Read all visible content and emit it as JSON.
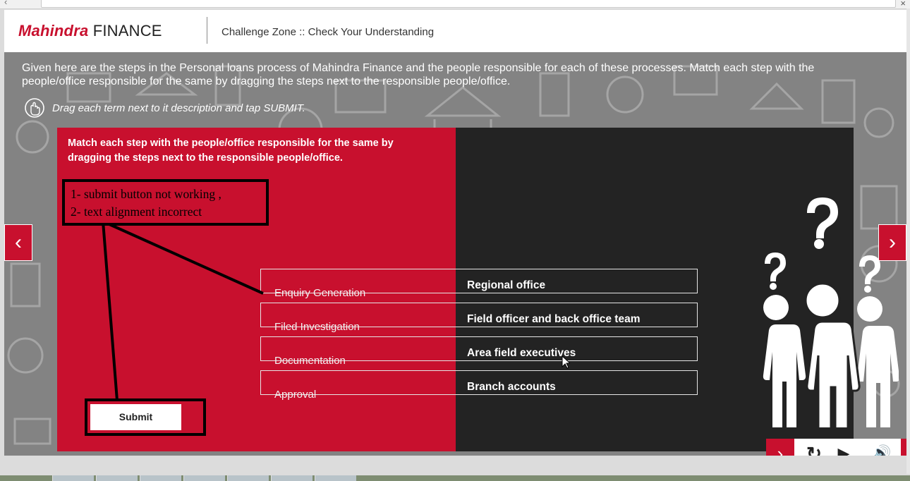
{
  "header": {
    "logo_brand": "Mahindra",
    "logo_suffix": "FINANCE",
    "title": "Challenge Zone :: Check Your Understanding"
  },
  "intro": {
    "text": "Given here are the steps in the Personal loans process of Mahindra Finance and the people responsible for each of these processes. Match each step with the people/office responsible for the same by dragging the steps next to the responsible people/office.",
    "hint": "Drag each term next to it description and tap SUBMIT."
  },
  "activity": {
    "instruction": "Match each step with the people/office responsible for the same by dragging the steps next to the responsible people/office.",
    "rows": [
      {
        "step": "Enquiry Generation",
        "target": "Regional office"
      },
      {
        "step": "Filed Investigation",
        "target": "Field officer and back office team"
      },
      {
        "step": "Documentation",
        "target": "Area field executives"
      },
      {
        "step": "Approval",
        "target": "Branch accounts"
      }
    ],
    "submit_label": "Submit"
  },
  "annotation": {
    "line1": "1- submit button not working ,",
    "line2": "2- text alignment incorrect"
  },
  "navigation": {
    "prev_glyph": "‹",
    "next_glyph": "›"
  },
  "controls": {
    "next_glyph": "›",
    "replay_glyph": "↻",
    "play_glyph": "▶",
    "volume_glyph": "🔊"
  },
  "colors": {
    "brand_red": "#c8102e",
    "dark_panel": "#232323",
    "stage_gray": "#838383"
  }
}
